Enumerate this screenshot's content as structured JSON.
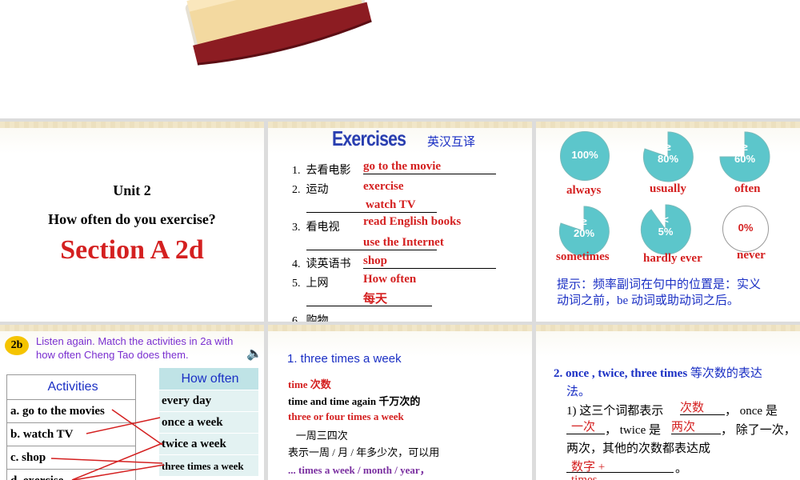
{
  "slide1": {
    "unit": "Unit 2",
    "question": "How often do you exercise?",
    "section": "Section A 2d"
  },
  "slide2": {
    "title": "Exercises",
    "subtitle": "英汉互译",
    "items": [
      {
        "num": "1.",
        "cn": "去看电影"
      },
      {
        "num": "2.",
        "cn": "运动"
      },
      {
        "num": "3.",
        "cn": "看电视"
      },
      {
        "num": "4.",
        "cn": "读英语书"
      },
      {
        "num": "5.",
        "cn": "上网"
      },
      {
        "num": "6.",
        "cn": "购物"
      }
    ],
    "answers": [
      "go to the movie",
      "exercise",
      "watch TV",
      "read English books",
      "use the Internet",
      "shop",
      "How often",
      "每天"
    ]
  },
  "slide3": {
    "circles": [
      {
        "pct": "100%",
        "label": "always"
      },
      {
        "pct": "≥\n80%",
        "label": "usually"
      },
      {
        "pct": "≥\n60%",
        "label": "often"
      },
      {
        "pct": "≥\n20%",
        "label": "sometimes"
      },
      {
        "pct": "<\n5%",
        "label": "hardly ever"
      },
      {
        "pct": "0%",
        "label": "never"
      }
    ],
    "tip_line1": "提示：频率副词在句中的位置是：实义",
    "tip_line2": "动词之前，be 动词或助动词之后。"
  },
  "slide4": {
    "badge": "2b",
    "instruction": "Listen again. Match the activities in 2a with how often Cheng Tao does them.",
    "left_header": "Activities",
    "left_items": [
      "a.  go to the movies",
      "b.  watch TV",
      "c.  shop",
      "d.  exercise"
    ],
    "right_header": "How often",
    "right_items": [
      "every day",
      "once a week",
      "twice a week",
      "three times a week"
    ]
  },
  "slide5": {
    "title": "1. three times a week",
    "lines": [
      {
        "text": "time   次数",
        "style": "red"
      },
      {
        "text": "time and time again   千万次的",
        "style": "black"
      },
      {
        "text": "three or four times a week",
        "style": "red"
      },
      {
        "text": "   一周三四次",
        "style": "black"
      },
      {
        "text": "表示一周 / 月 / 年多少次，可以用",
        "style": "black"
      },
      {
        "text": "... times a week / month / year，",
        "style": "purple"
      }
    ]
  },
  "slide6": {
    "heading_blue": "2. once , twice, three times",
    "heading_rest": " 等次数的表达",
    "heading_line2": "法。",
    "l1_a": "1)  这三个词都表示",
    "l1_ans": "次数",
    "l1_b": "，  once 是",
    "l2_ans": "一次",
    "l2_a": "，  twice 是",
    "l2_ans2": "两次",
    "l2_b": "，  除了一次，",
    "l3": "两次，其他的次数都表达成",
    "l4_ans": "数字  +",
    "l4_end": "。",
    "l5_ans": "times"
  }
}
